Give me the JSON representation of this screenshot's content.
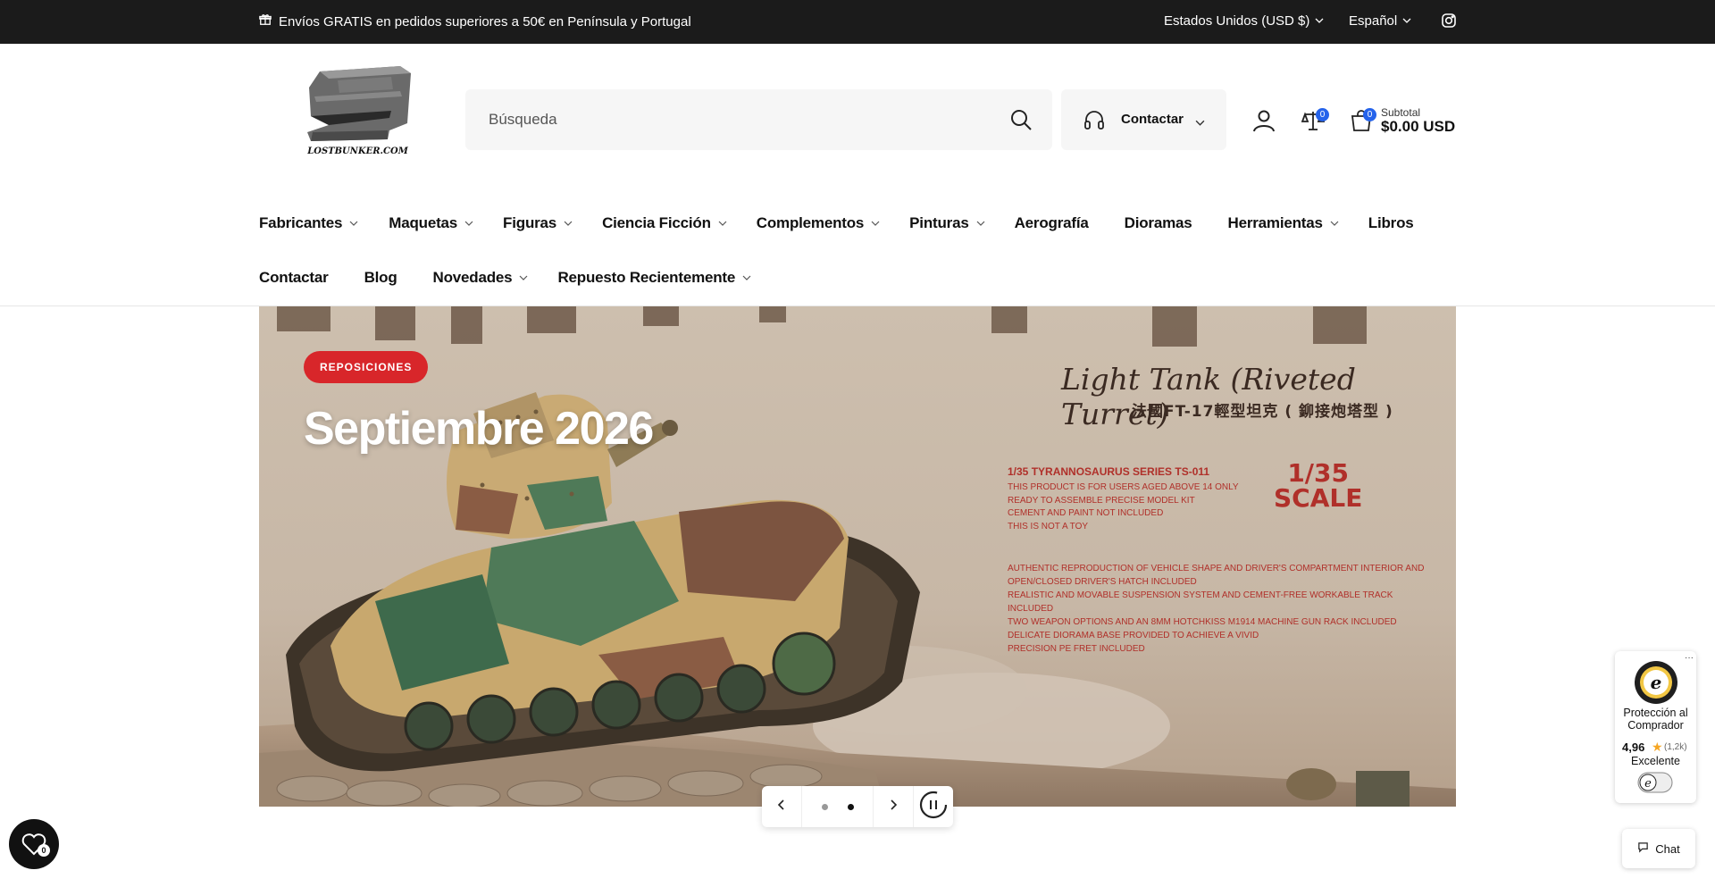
{
  "announcement": {
    "promo": "Envíos GRATIS en pedidos superiores a 50€ en Península y Portugal",
    "currency": "Estados Unidos (USD $)",
    "language": "Español"
  },
  "header": {
    "logo_text": "LOSTBUNKER.COM",
    "search_placeholder": "Búsqueda",
    "contact_label": "Contactar",
    "compare_count": "0",
    "cart_count": "0",
    "subtotal_label": "Subtotal",
    "subtotal_value": "$0.00 USD"
  },
  "nav": {
    "row1": [
      {
        "label": "Fabricantes",
        "dropdown": true
      },
      {
        "label": "Maquetas",
        "dropdown": true
      },
      {
        "label": "Figuras",
        "dropdown": true
      },
      {
        "label": "Ciencia Ficción",
        "dropdown": true
      },
      {
        "label": "Complementos",
        "dropdown": true
      },
      {
        "label": "Pinturas",
        "dropdown": true
      },
      {
        "label": "Aerografía",
        "dropdown": false
      },
      {
        "label": "Dioramas",
        "dropdown": false
      },
      {
        "label": "Herramientas",
        "dropdown": true
      },
      {
        "label": "Libros",
        "dropdown": false
      }
    ],
    "row2": [
      {
        "label": "Contactar",
        "dropdown": false
      },
      {
        "label": "Blog",
        "dropdown": false
      },
      {
        "label": "Novedades",
        "dropdown": true
      },
      {
        "label": "Repuesto Recientemente",
        "dropdown": true
      }
    ]
  },
  "hero": {
    "tag": "REPOSICIONES",
    "headline": "Septiembre 2026",
    "box_title": "Light Tank (Riveted Turret)",
    "box_subtitle": "法國FT-17輕型坦克 ( 鉚接炮塔型 )",
    "box_series": "1/35 TYRANNOSAURUS SERIES TS-011",
    "box_lines": [
      "THIS PRODUCT IS FOR USERS AGED ABOVE 14 ONLY",
      "READY TO ASSEMBLE PRECISE MODEL KIT",
      "CEMENT AND PAINT NOT INCLUDED",
      "THIS IS NOT A TOY"
    ],
    "box_scale_1": "1/35",
    "box_scale_2": "SCALE",
    "box_features": [
      "AUTHENTIC REPRODUCTION OF VEHICLE SHAPE AND DRIVER'S COMPARTMENT INTERIOR AND OPEN/CLOSED DRIVER'S HATCH INCLUDED",
      "REALISTIC AND MOVABLE SUSPENSION SYSTEM AND CEMENT-FREE WORKABLE TRACK INCLUDED",
      "TWO WEAPON OPTIONS AND AN 8MM HOTCHKISS M1914 MACHINE GUN RACK INCLUDED",
      "DELICATE DIORAMA BASE PROVIDED TO ACHIEVE A VIVID",
      "PRECISION PE FRET INCLUDED"
    ],
    "slides_total": 2,
    "active_slide": 2
  },
  "trust_badge": {
    "title": "Protección al Comprador",
    "score": "4,96",
    "count": "(1,2k)",
    "rating_text": "Excelente"
  },
  "wishlist": {
    "count": "0"
  },
  "chat": {
    "label": "Chat"
  },
  "colors": {
    "topbar_bg": "#1b1b1b",
    "accent_badge": "#2563eb",
    "tag_red": "#d8262a",
    "trust_star": "#f6a623"
  }
}
